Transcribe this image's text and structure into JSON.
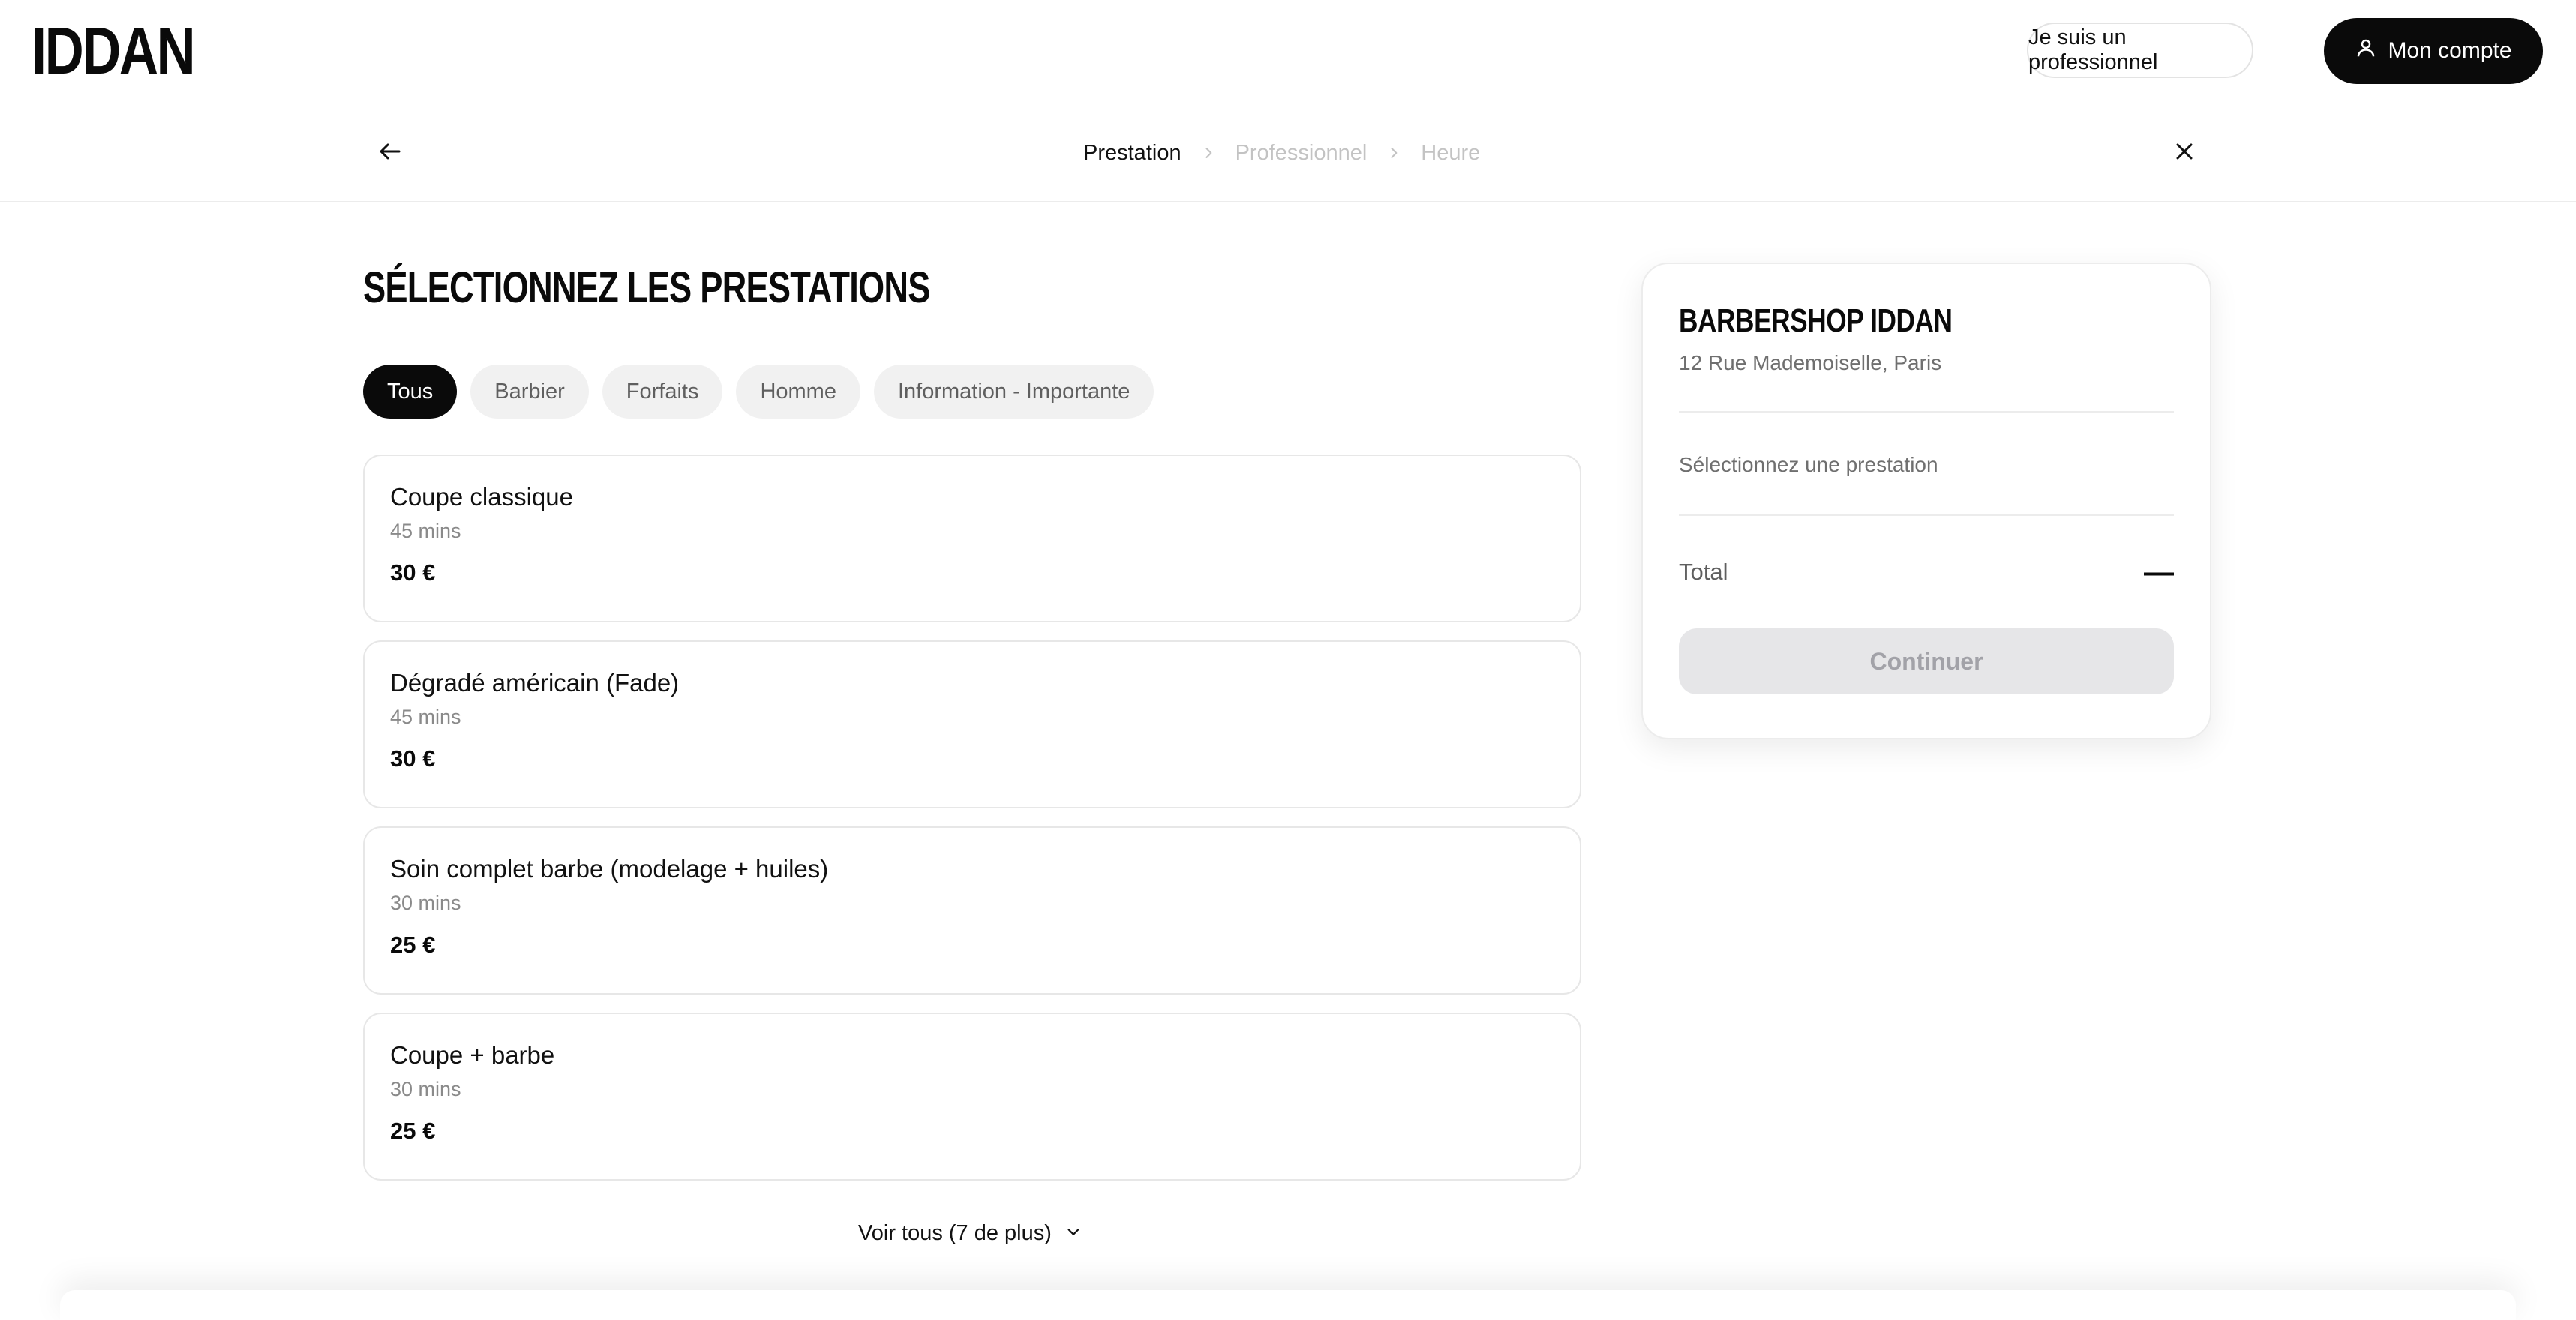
{
  "header": {
    "logo": "IDDAN",
    "pro_label": "Je suis un professionnel",
    "account_label": "Mon compte"
  },
  "stepper": {
    "steps": [
      {
        "label": "Prestation",
        "active": true
      },
      {
        "label": "Professionnel",
        "active": false
      },
      {
        "label": "Heure",
        "active": false
      }
    ]
  },
  "main": {
    "title": "Sélectionnez les prestations",
    "tabs": [
      {
        "label": "Tous",
        "active": true
      },
      {
        "label": "Barbier",
        "active": false
      },
      {
        "label": "Forfaits",
        "active": false
      },
      {
        "label": "Homme",
        "active": false
      },
      {
        "label": "Information - Importante",
        "active": false
      }
    ],
    "services": [
      {
        "name": "Coupe classique",
        "duration": "45 mins",
        "price": "30 €"
      },
      {
        "name": "Dégradé américain (Fade)",
        "duration": "45 mins",
        "price": "30 €"
      },
      {
        "name": "Soin complet barbe (modelage + huiles)",
        "duration": "30 mins",
        "price": "25 €"
      },
      {
        "name": "Coupe + barbe",
        "duration": "30 mins",
        "price": "25 €"
      }
    ],
    "see_all_label": "Voir tous (7 de plus)"
  },
  "summary": {
    "shop_name": "BARBERSHOP IDDAN",
    "address": "12 Rue Mademoiselle, Paris",
    "placeholder": "Sélectionnez une prestation",
    "total_label": "Total",
    "total_value": "—",
    "continue_label": "Continuer"
  },
  "icons": {
    "back": "arrow-left-icon",
    "close": "close-icon",
    "user": "user-icon",
    "step_separator": "chevron-right-icon",
    "see_all": "chevron-down-icon"
  },
  "colors": {
    "primary": "#0a0a0a",
    "tab_bg": "#f1f1f1",
    "disabled_bg": "#e6e6e8",
    "disabled_text": "#a2a2a8",
    "inactive_step": "#c3c3c3"
  }
}
